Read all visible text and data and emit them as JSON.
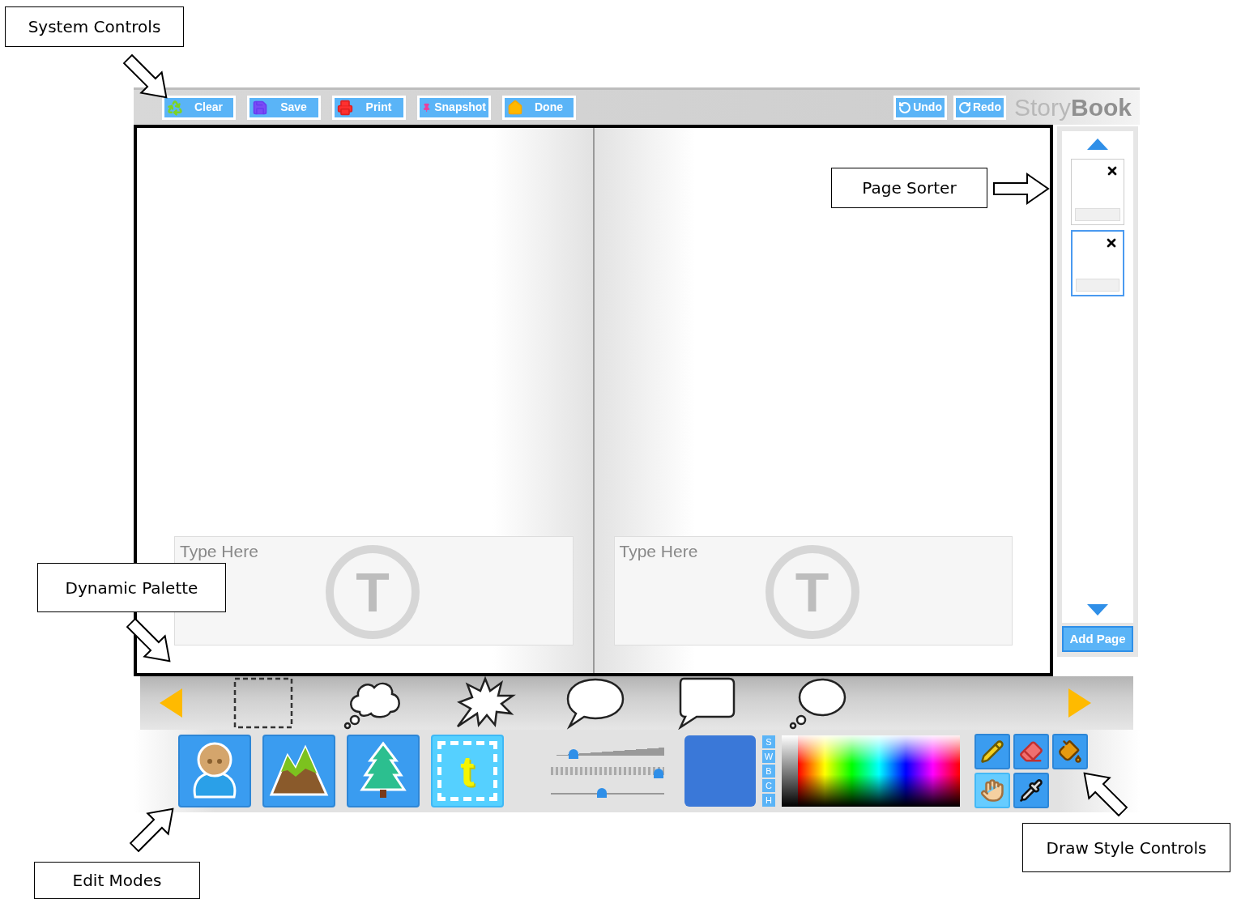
{
  "annotations": [
    {
      "label": "System Controls"
    },
    {
      "label": "Page Sorter"
    },
    {
      "label": "Dynamic Palette"
    },
    {
      "label": "Edit Modes"
    },
    {
      "label": "Draw Style Controls"
    }
  ],
  "toolbar": {
    "left_buttons": [
      "Clear",
      "Save",
      "Print",
      "Snapshot",
      "Done"
    ],
    "right_buttons": [
      "Undo",
      "Redo"
    ],
    "brand_light": "Story",
    "brand_bold": "Book"
  },
  "pages": [
    {
      "placeholder": "Type Here",
      "watermark": "T"
    },
    {
      "placeholder": "Type Here",
      "watermark": "T"
    }
  ],
  "page_sorter": {
    "thumbnails": [
      {
        "selected": false
      },
      {
        "selected": true
      }
    ],
    "add_button": "Add Page"
  },
  "edit_modes": [
    {
      "selected": false
    },
    {
      "selected": false
    },
    {
      "selected": false
    },
    {
      "selected": true,
      "glyph": "t"
    }
  ],
  "sliders": [
    {
      "level": 0.2
    },
    {
      "level": 0.95
    },
    {
      "level": 0.45
    }
  ],
  "color_modes": [
    "S",
    "W",
    "B",
    "C",
    "H"
  ],
  "draw_tools": [
    {
      "selected": false
    },
    {
      "selected": false
    },
    {
      "selected": false
    },
    {
      "selected": true
    },
    {
      "selected": false
    }
  ]
}
